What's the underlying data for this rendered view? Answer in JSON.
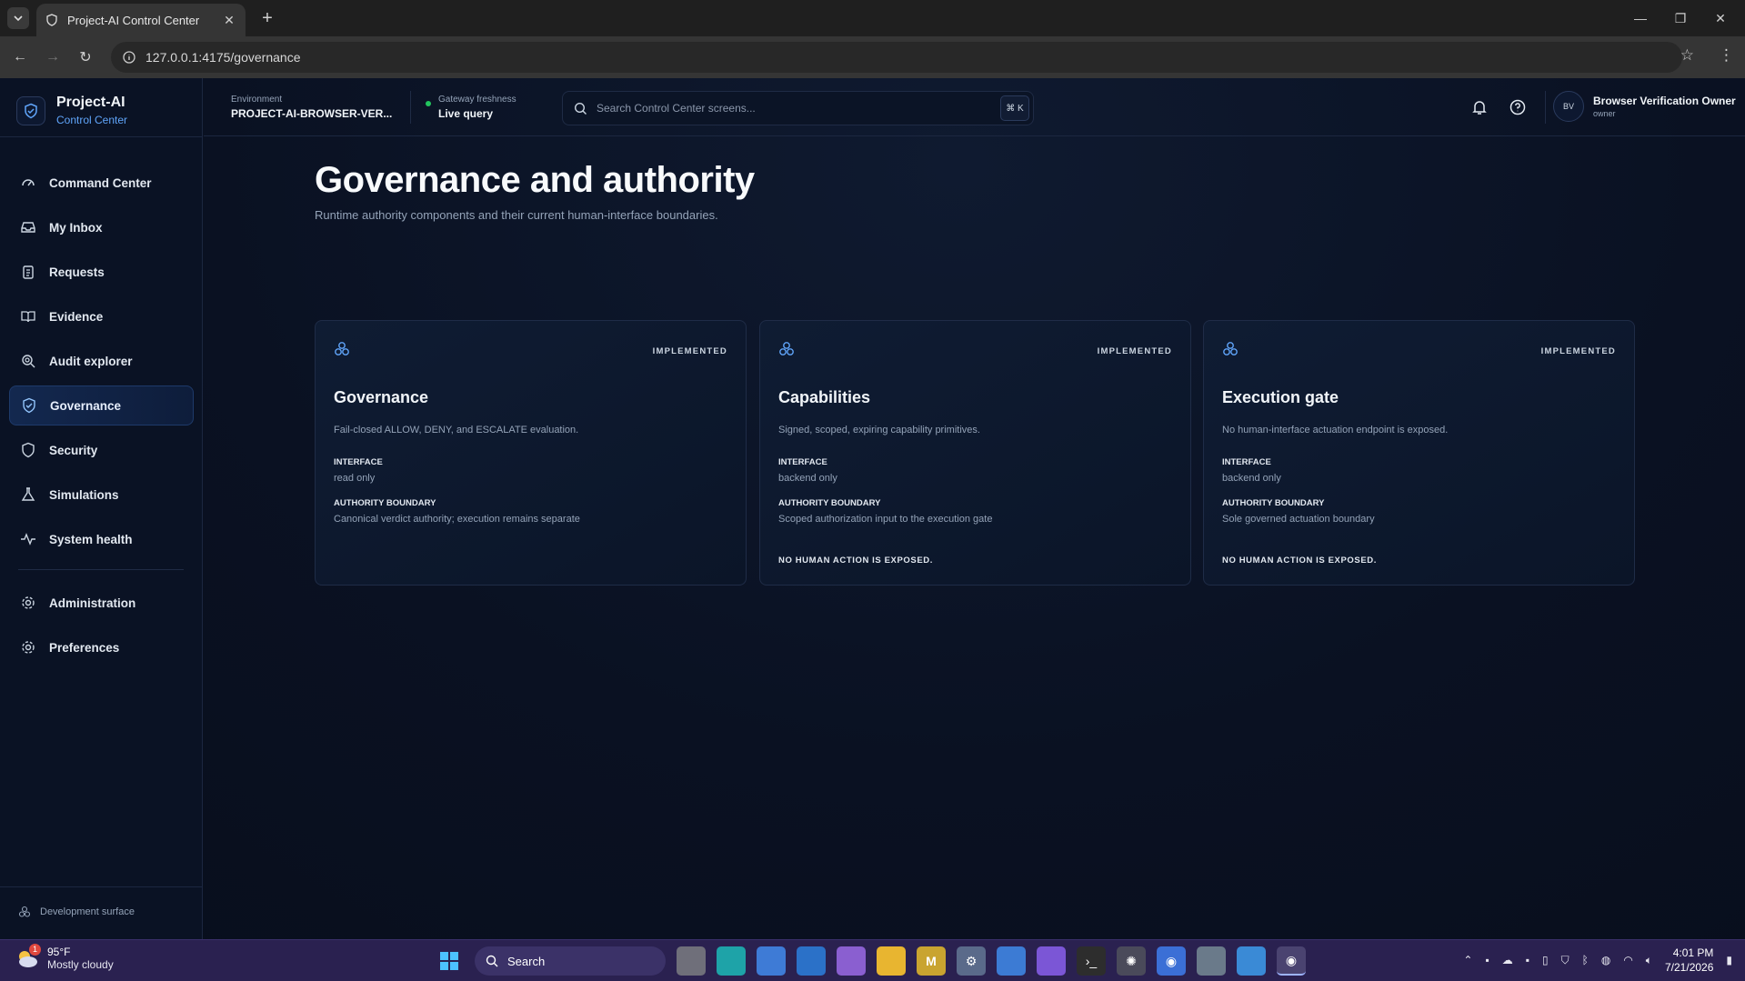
{
  "browser": {
    "tab_title": "Project-AI Control Center",
    "url": "127.0.0.1:4175/governance"
  },
  "brand": {
    "name": "Project-AI",
    "subtitle": "Control Center"
  },
  "nav": {
    "primary": [
      {
        "label": "Command Center",
        "icon": "gauge-icon"
      },
      {
        "label": "My Inbox",
        "icon": "inbox-icon"
      },
      {
        "label": "Requests",
        "icon": "clipboard-icon"
      },
      {
        "label": "Evidence",
        "icon": "book-icon"
      },
      {
        "label": "Audit explorer",
        "icon": "audit-search-icon"
      },
      {
        "label": "Governance",
        "icon": "shield-check-icon",
        "active": true
      },
      {
        "label": "Security",
        "icon": "shield-icon"
      },
      {
        "label": "Simulations",
        "icon": "flask-icon"
      },
      {
        "label": "System health",
        "icon": "activity-icon"
      }
    ],
    "secondary": [
      {
        "label": "Administration",
        "icon": "gear-icon"
      },
      {
        "label": "Preferences",
        "icon": "gear-icon"
      }
    ],
    "footer": "Development surface"
  },
  "header": {
    "environment_label": "Environment",
    "environment_value": "PROJECT-AI-BROWSER-VER...",
    "freshness_label": "Gateway freshness",
    "freshness_value": "Live query",
    "search_placeholder": "Search Control Center screens...",
    "search_shortcut": "⌘ K",
    "user_initials": "BV",
    "user_name": "Browser Verification Owner",
    "user_role": "owner"
  },
  "page": {
    "title": "Governance and authority",
    "subtitle": "Runtime authority components and their current human-interface boundaries."
  },
  "cards": [
    {
      "status": "IMPLEMENTED",
      "title": "Governance",
      "description": "Fail-closed ALLOW, DENY, and ESCALATE evaluation.",
      "interface_label": "INTERFACE",
      "interface_value": "read only",
      "boundary_label": "AUTHORITY BOUNDARY",
      "boundary_value": "Canonical verdict authority; execution remains separate",
      "note": ""
    },
    {
      "status": "IMPLEMENTED",
      "title": "Capabilities",
      "description": "Signed, scoped, expiring capability primitives.",
      "interface_label": "INTERFACE",
      "interface_value": "backend only",
      "boundary_label": "AUTHORITY BOUNDARY",
      "boundary_value": "Scoped authorization input to the execution gate",
      "note": "NO HUMAN ACTION IS EXPOSED."
    },
    {
      "status": "IMPLEMENTED",
      "title": "Execution gate",
      "description": "No human-interface actuation endpoint is exposed.",
      "interface_label": "INTERFACE",
      "interface_value": "backend only",
      "boundary_label": "AUTHORITY BOUNDARY",
      "boundary_value": "Sole governed actuation boundary",
      "note": "NO HUMAN ACTION IS EXPOSED."
    }
  ],
  "taskbar": {
    "weather_temp": "95°F",
    "weather_desc": "Mostly cloudy",
    "weather_badge": "1",
    "search_label": "Search",
    "time": "4:01 PM",
    "date": "7/21/2026"
  },
  "colors": {
    "accent": "#60a5fa",
    "live": "#22c55e",
    "taskbar": "#2a2150"
  }
}
